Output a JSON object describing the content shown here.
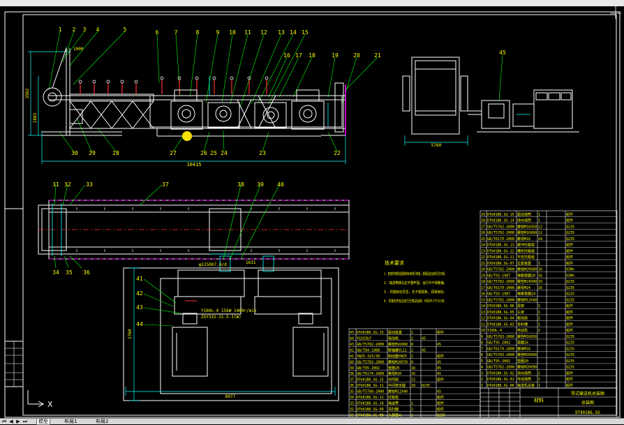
{
  "colors": {
    "background": "#000000",
    "line_white": "#ffffff",
    "line_cyan": "#00ffff",
    "line_yellow": "#ffff00",
    "line_green": "#00ff00",
    "line_red": "#ff3030",
    "line_magenta": "#ff00ff",
    "cursor_highlight": "#f5e000"
  },
  "side_view": {
    "callouts_top": [
      "1",
      "2",
      "3",
      "4",
      "5",
      "6",
      "7",
      "8",
      "9",
      "10",
      "11",
      "12",
      "13",
      "14",
      "15",
      "16",
      "17",
      "18",
      "19",
      "20",
      "21"
    ],
    "callouts_bottom": [
      "30",
      "29",
      "28",
      "27",
      "26",
      "25",
      "24",
      "23",
      "22"
    ],
    "dim_bottom": "10415",
    "dim_left_a": "3562",
    "dim_left_b": "1883",
    "dim_top_small": "1000"
  },
  "end_view": {
    "callout": "45",
    "dim_bottom": "5760"
  },
  "plan_view": {
    "callouts": [
      "31",
      "32",
      "33",
      "37",
      "38",
      "39",
      "40",
      "34",
      "35",
      "36"
    ],
    "gear_label": "φ1250X7.4/d",
    "dim_label": "1631"
  },
  "drive_view": {
    "callouts": [
      "41",
      "42",
      "43",
      "44"
    ],
    "annotation_1": "Y160L-4 15kW 1460r/min",
    "annotation_2": "ZSY315-31.5-I(W)",
    "dim_left": "3760",
    "dim_bottom": "8077"
  },
  "notes": {
    "title": "技术要求",
    "lines": [
      "1. 各部件按相应图纸和标准进行制造，装配后应运转灵活可靠。",
      "2. 输送带接头应平整牢固，运行中不得跑偏。",
      "3. 托辊转动灵活，无卡阻现象，润滑良好。",
      "4. 安装完毕后应进行空载试运转，时间不少于2小时。"
    ]
  },
  "bom_left": {
    "rows": [
      [
        "45",
        "DTⅡ01B6.SG-15",
        "驱动装置",
        "1",
        "",
        "组件"
      ],
      [
        "44",
        "YGIO3b7",
        "电动机",
        "2",
        "45",
        ""
      ],
      [
        "43",
        "GB/T5782-2000",
        "螺栓M16X60",
        "8",
        "",
        "45"
      ],
      [
        "42",
        "GB/T84-1988",
        "联轴器YL11",
        "2",
        "45",
        ""
      ],
      [
        "41",
        "YWZ5-315/30",
        "制动器YWZ5",
        "2",
        "",
        "组件"
      ],
      [
        "40",
        "GB/T5783-2000",
        "螺栓M20X70",
        "8",
        "",
        "45"
      ],
      [
        "39",
        "GB/T95-2002",
        "垫圈20",
        "16",
        "",
        "45"
      ],
      [
        "38",
        "GB/T6170-2000",
        "螺母M20",
        "16",
        "",
        "45"
      ],
      [
        "37",
        "DTⅡ01B6.SG-15",
        "中间架",
        "12",
        "",
        "组件"
      ],
      [
        "36",
        "DTⅡ01B6.SG-11",
        "中间架支腿",
        "18",
        "Q235",
        ""
      ],
      [
        "35",
        "GB/T5780-2000",
        "螺栓M12X40",
        "",
        "",
        "45"
      ],
      [
        "34",
        "DTⅡ01B6.SG-11",
        "托辊组",
        "",
        "",
        "组件"
      ],
      [
        "33",
        "DTⅡ01B6.SG-10",
        "输送带",
        "1",
        "",
        "组件"
      ],
      [
        "32",
        "DTⅡ01B6.SG-09",
        "清扫器",
        "2",
        "",
        "组件"
      ],
      [
        "31",
        "DTⅡ01B6.SG-08",
        "头部漏斗",
        "1",
        "",
        "Q235"
      ]
    ]
  },
  "bom_right": {
    "rows": [
      [
        "29",
        "DTⅡ01B6.SG-15",
        "驱动滚筒",
        "1",
        "",
        "组件"
      ],
      [
        "28",
        "DTⅡ01B6.SG-14",
        "改向滚筒",
        "1",
        "",
        "组件"
      ],
      [
        "27",
        "GB/T5782-2000",
        "螺栓M16X50",
        "12",
        "",
        "Q235"
      ],
      [
        "26",
        "GB/T5782-2000",
        "螺栓M16X60",
        "12",
        "",
        "Q235"
      ],
      [
        "25",
        "GB/T6170-2000",
        "螺母M16",
        "24",
        "",
        "Q235"
      ],
      [
        "24",
        "DTⅡ01B6.SG-13",
        "缓冲托辊组",
        "",
        "",
        "组件"
      ],
      [
        "23",
        "DTⅡ01B6.SG-12",
        "槽形托辊组",
        "",
        "",
        "组件"
      ],
      [
        "22",
        "DTⅡ01B6.SG-11",
        "平形托辊组",
        "",
        "",
        "组件"
      ],
      [
        "21",
        "DTⅡ01B6.SG-07",
        "拉紧装置",
        "1",
        "",
        "组件"
      ],
      [
        "20",
        "GB/T5782-2000",
        "螺栓M20X80",
        "16",
        "",
        "65Mn"
      ],
      [
        "19",
        "GB/T93-1987",
        "弹簧垫圈20",
        "16",
        "",
        "65Mn"
      ],
      [
        "18",
        "GB/T5782-2000",
        "螺栓M24X90",
        "16",
        "",
        "Q235"
      ],
      [
        "17",
        "GB/T6170-2000",
        "螺母M24",
        "16",
        "",
        "Q235"
      ],
      [
        "16",
        "GB/T93-1987",
        "弹簧垫圈24",
        "",
        "",
        "Q235"
      ],
      [
        "15",
        "GB/T5782-2000",
        "螺栓M12X40",
        "",
        "",
        "Q235"
      ],
      [
        "14",
        "DTⅡ01B6.SG-06",
        "尾架",
        "1",
        "",
        "组件"
      ],
      [
        "13",
        "DTⅡ01B6.SG-05",
        "头架",
        "1",
        "",
        "组件"
      ],
      [
        "12",
        "DTⅡ01B6.SG-04",
        "驱动架",
        "2",
        "",
        "组件"
      ],
      [
        "11",
        "DTⅡ01B6.SG-03",
        "导料槽",
        "1",
        "",
        "组件"
      ],
      [
        "10",
        "Y160L-4",
        "电动机",
        "2",
        "",
        "组件"
      ],
      [
        "9",
        "GB/T5783-2000",
        "螺栓M16X50",
        "",
        "",
        "Q235"
      ],
      [
        "8",
        "GB/T95-2002",
        "垫圈16",
        "",
        "",
        "Q235"
      ],
      [
        "7",
        "GB/T6170-2000",
        "螺母M16",
        "",
        "",
        "Q235"
      ],
      [
        "6",
        "GB/T5783-2000",
        "螺栓M20X60",
        "",
        "",
        "Q235"
      ],
      [
        "5",
        "GB/T95-2002",
        "垫圈20",
        "",
        "",
        "Q235"
      ],
      [
        "4",
        "GB/T5782-2000",
        "螺栓M20X90",
        "",
        "",
        "Q235"
      ],
      [
        "3",
        "DTⅡ01B6.SG-02",
        "改向滚筒",
        "1",
        "",
        "组件"
      ],
      [
        "2",
        "DTⅡ01B6.SG-01",
        "传动滚筒",
        "1",
        "",
        "组件"
      ],
      [
        "1",
        "DTⅡ01B6.SG-00",
        "输送机总装",
        "1",
        "",
        "组件"
      ]
    ]
  },
  "title_block": {
    "drawing_name": "带式输送机总装图",
    "drawing_no": "DTⅡ01B6.SG",
    "sheet_label": "总装图",
    "stamp": "材料"
  },
  "ucs": {
    "x_label": "X"
  },
  "tabs": {
    "items": [
      "模型",
      "布局1",
      "布局2"
    ],
    "active_index": 0
  }
}
